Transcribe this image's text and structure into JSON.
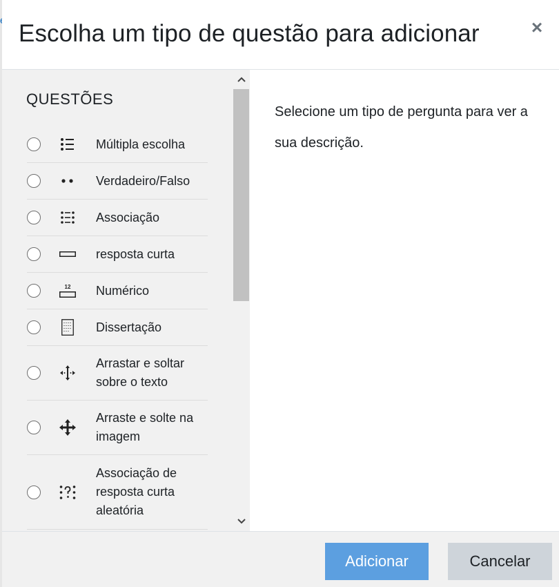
{
  "dialog": {
    "title": "Escolha um tipo de questão para adicionar",
    "close_symbol": "×"
  },
  "questions": {
    "section_title": "QUESTÕES",
    "items": [
      {
        "label": "Múltipla escolha",
        "icon": "multichoice-icon"
      },
      {
        "label": "Verdadeiro/Falso",
        "icon": "truefalse-icon"
      },
      {
        "label": "Associação",
        "icon": "match-icon"
      },
      {
        "label": "resposta curta",
        "icon": "shortanswer-icon"
      },
      {
        "label": "Numérico",
        "icon": "numerical-icon",
        "icon_text": "12"
      },
      {
        "label": "Dissertação",
        "icon": "essay-icon"
      },
      {
        "label": "Arrastar e soltar sobre o texto",
        "icon": "ddwtos-icon"
      },
      {
        "label": "Arraste e solte na imagem",
        "icon": "ddimageortext-icon"
      },
      {
        "label": "Associação de resposta curta aleatória",
        "icon": "randomsamatch-icon"
      }
    ]
  },
  "description": {
    "text": "Selecione um tipo de pergunta para ver a sua descrição."
  },
  "footer": {
    "add_label": "Adicionar",
    "cancel_label": "Cancelar"
  },
  "colors": {
    "primary": "#5c9fe0",
    "secondary": "#ced4da",
    "pane_bg": "#f1f1f1"
  }
}
